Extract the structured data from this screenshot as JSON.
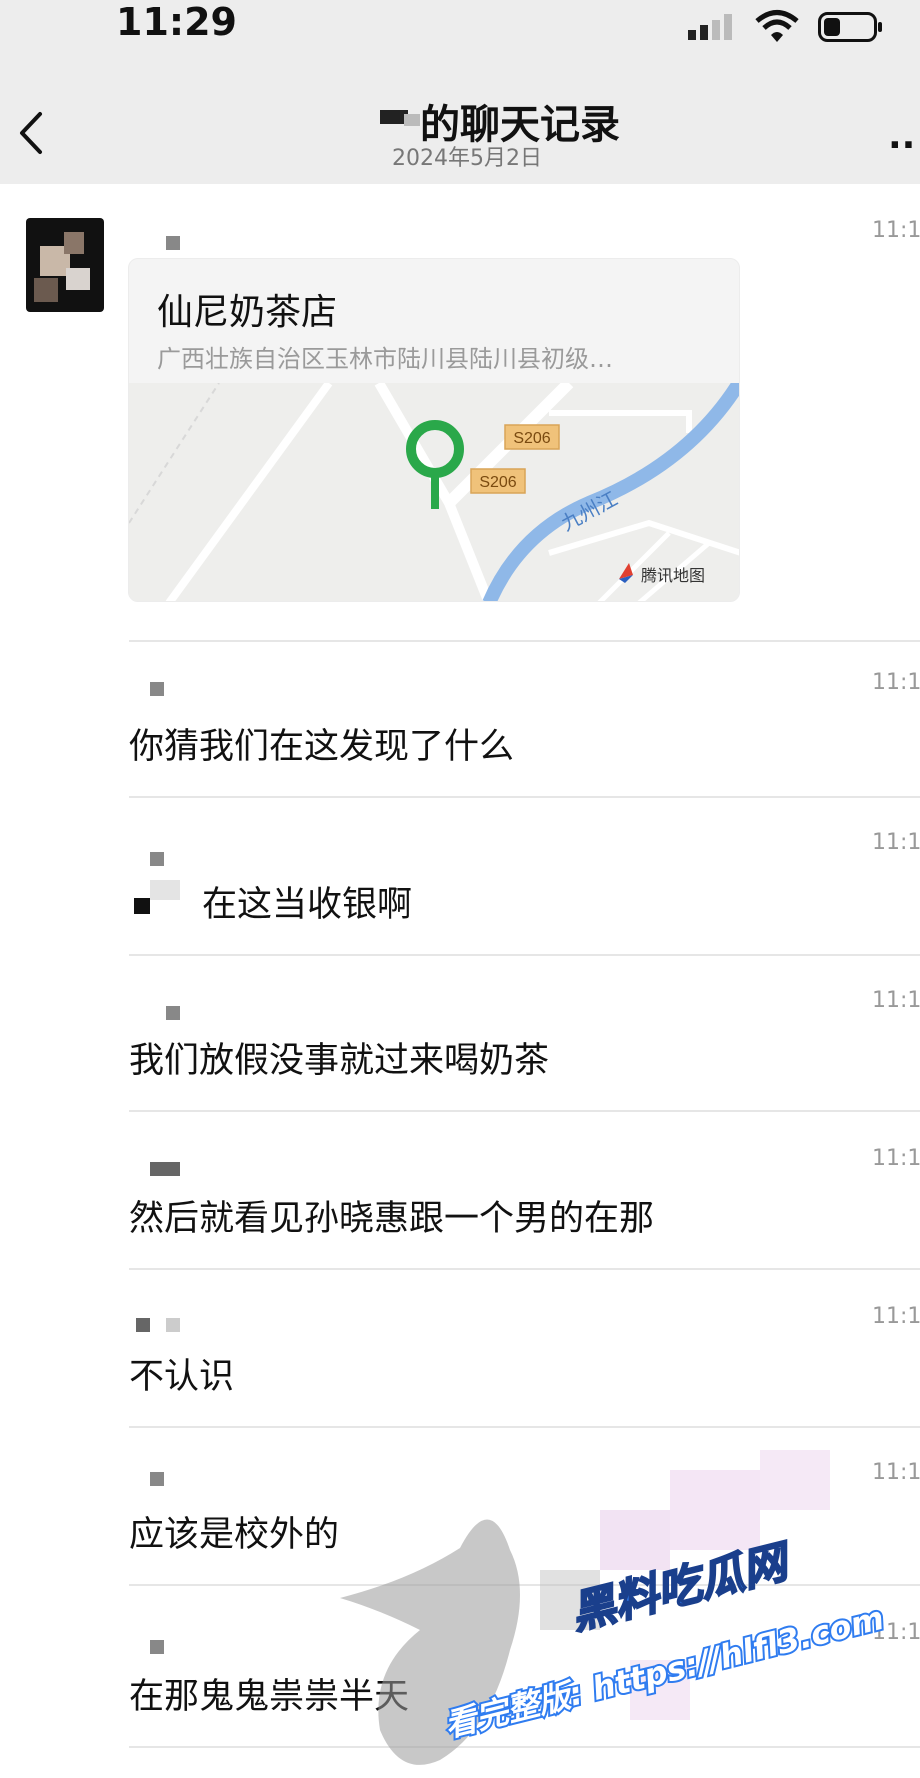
{
  "status_bar": {
    "time": "11:29"
  },
  "nav": {
    "title": "的聊天记录",
    "date": "2024年5月2日",
    "more": "··"
  },
  "location": {
    "name": "仙尼奶茶店",
    "address": "广西壮族自治区玉林市陆川县陆川县初级…",
    "map_labels": {
      "road1": "S206",
      "road2": "S206",
      "river": "九州江",
      "provider": "腾讯地图"
    }
  },
  "messages": [
    {
      "time": "11:1",
      "text": ""
    },
    {
      "time": "11:1",
      "text": "你猜我们在这发现了什么"
    },
    {
      "time": "11:1",
      "text": "在这当收银啊"
    },
    {
      "time": "11:1",
      "text": "我们放假没事就过来喝奶茶"
    },
    {
      "time": "11:1",
      "text": "然后就看见孙晓惠跟一个男的在那"
    },
    {
      "time": "11:1",
      "text": "不认识"
    },
    {
      "time": "11:1",
      "text": "应该是校外的"
    },
    {
      "time": "11:1",
      "text": "在那鬼鬼祟祟半天"
    }
  ],
  "watermark": {
    "brand": "黑料吃瓜网",
    "url_line": "看完整版: https://hlfl3.com"
  },
  "colors": {
    "nav_bg": "#ededed",
    "pin": "#2aa84a",
    "river": "#8fb8e8",
    "road_tag": "#f0c27a"
  },
  "icons": [
    "back-icon",
    "more-icon",
    "signal-icon",
    "wifi-icon",
    "battery-icon",
    "map-pin-icon"
  ]
}
